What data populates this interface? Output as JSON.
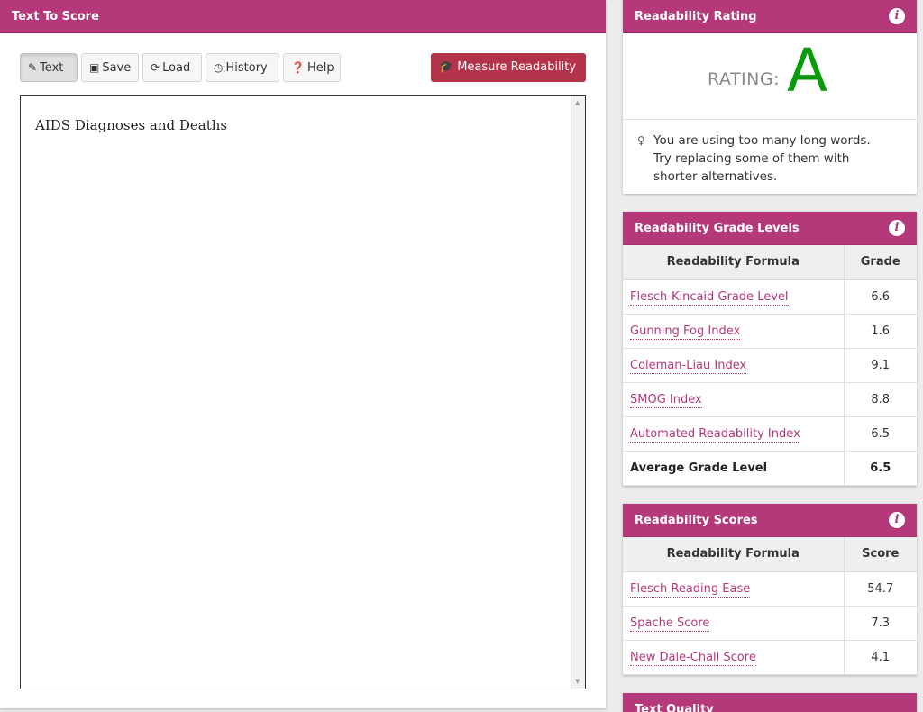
{
  "left_panel": {
    "title": "Text To Score",
    "toolbar": {
      "text_label": "Text",
      "save_label": "Save",
      "load_label": "Load",
      "history_label": "History",
      "help_label": "Help",
      "measure_label": "Measure Readability"
    },
    "editor": {
      "content": "AIDS Diagnoses and Deaths"
    }
  },
  "rating_panel": {
    "title": "Readability Rating",
    "rating_label": "RATING:",
    "rating_value": "A",
    "tip": "You are using too many long words. Try replacing some of them with shorter alternatives."
  },
  "grades_panel": {
    "title": "Readability Grade Levels",
    "col_formula": "Readability Formula",
    "col_value": "Grade",
    "rows": [
      {
        "name": "Flesch-Kincaid Grade Level",
        "value": "6.6"
      },
      {
        "name": "Gunning Fog Index",
        "value": "1.6"
      },
      {
        "name": "Coleman-Liau Index",
        "value": "9.1"
      },
      {
        "name": "SMOG Index",
        "value": "8.8"
      },
      {
        "name": "Automated Readability Index",
        "value": "6.5"
      }
    ],
    "avg_label": "Average Grade Level",
    "avg_value": "6.5"
  },
  "scores_panel": {
    "title": "Readability Scores",
    "col_formula": "Readability Formula",
    "col_value": "Score",
    "rows": [
      {
        "name": "Flesch Reading Ease",
        "value": "54.7"
      },
      {
        "name": "Spache Score",
        "value": "7.3"
      },
      {
        "name": "New Dale-Chall Score",
        "value": "4.1"
      }
    ]
  },
  "quality_panel": {
    "title": "Text Quality"
  },
  "colors": {
    "accent": "#b5397a",
    "measure_button": "#b3344a",
    "rating_green": "#0a9b0a"
  }
}
